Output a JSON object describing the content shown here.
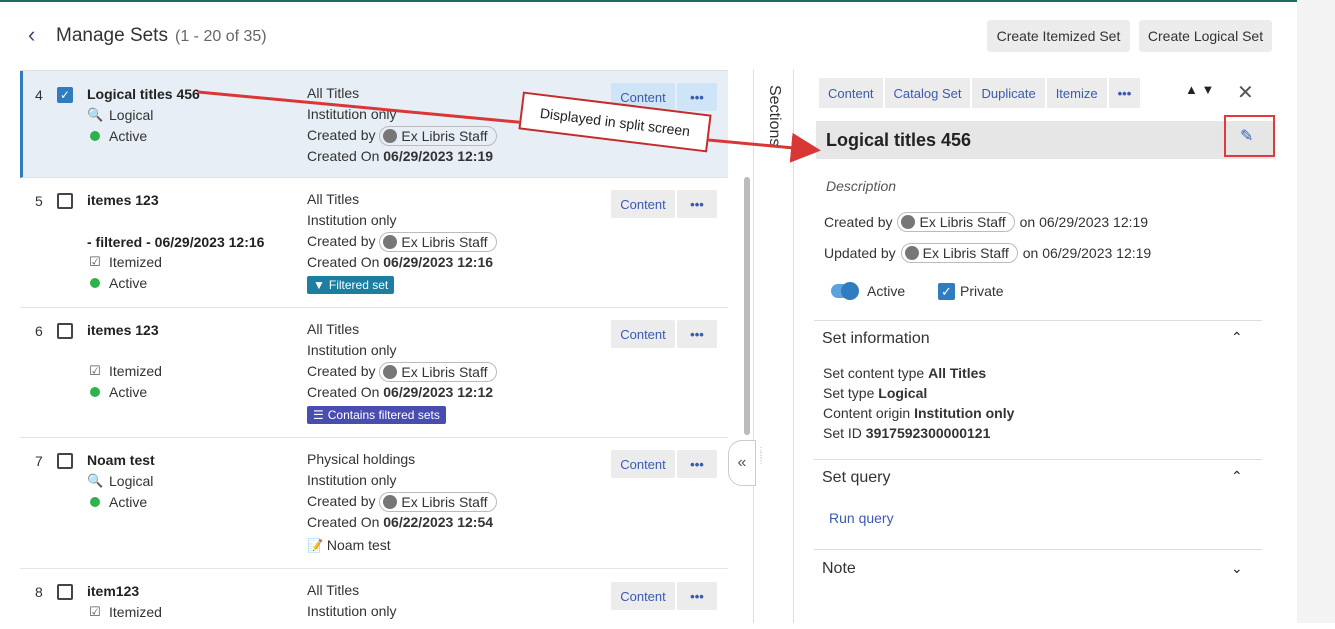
{
  "header": {
    "back_icon": "chevron-left-icon",
    "title": "Manage Sets",
    "count": "(1 - 20 of 35)",
    "create_itemized": "Create Itemized Set",
    "create_logical": "Create Logical Set"
  },
  "rows": [
    {
      "num": "4",
      "name": "Logical titles 456",
      "extra_name": "",
      "type": "Logical",
      "status": "Active",
      "content_type": "All Titles",
      "origin": "Institution only",
      "created_by_label": "Created by",
      "created_by": "Ex Libris Staff",
      "created_on_label": "Created On",
      "created_on": "06/29/2023 12:19",
      "tag": "",
      "note": "",
      "selected": true
    },
    {
      "num": "5",
      "name": "itemes 123",
      "extra_name": "- filtered - 06/29/2023 12:16",
      "type": "Itemized",
      "status": "Active",
      "content_type": "All Titles",
      "origin": "Institution only",
      "created_by_label": "Created by",
      "created_by": "Ex Libris Staff",
      "created_on_label": "Created On",
      "created_on": "06/29/2023 12:16",
      "tag": "Filtered set",
      "note": "",
      "selected": false
    },
    {
      "num": "6",
      "name": "itemes 123",
      "extra_name": "",
      "type": "Itemized",
      "status": "Active",
      "content_type": "All Titles",
      "origin": "Institution only",
      "created_by_label": "Created by",
      "created_by": "Ex Libris Staff",
      "created_on_label": "Created On",
      "created_on": "06/29/2023 12:12",
      "tag": "Contains filtered sets",
      "note": "",
      "selected": false
    },
    {
      "num": "7",
      "name": "Noam test",
      "extra_name": "",
      "type": "Logical",
      "status": "Active",
      "content_type": "Physical holdings",
      "origin": "Institution only",
      "created_by_label": "Created by",
      "created_by": "Ex Libris Staff",
      "created_on_label": "Created On",
      "created_on": "06/22/2023 12:54",
      "tag": "",
      "note": "Noam test",
      "selected": false
    },
    {
      "num": "8",
      "name": "item123",
      "extra_name": "",
      "type": "Itemized",
      "status": "",
      "content_type": "All Titles",
      "origin": "Institution only",
      "created_by_label": "",
      "created_by": "",
      "created_on_label": "",
      "created_on": "",
      "tag": "",
      "note": "",
      "selected": false
    }
  ],
  "row_buttons": {
    "content": "Content",
    "more": "•••"
  },
  "sections_label": "Sections",
  "collapse_icon": "double-chevron-left-icon",
  "annotation": "Displayed in split screen",
  "detail": {
    "tabs": [
      "Content",
      "Catalog Set",
      "Duplicate",
      "Itemize",
      "•••"
    ],
    "title": "Logical titles 456",
    "description_label": "Description",
    "created_by_label": "Created by",
    "created_by": "Ex Libris Staff",
    "created_on": "on 06/29/2023 12:19",
    "updated_by_label": "Updated by",
    "updated_by": "Ex Libris Staff",
    "updated_on": "on 06/29/2023 12:19",
    "active_label": "Active",
    "private_label": "Private",
    "set_info_title": "Set information",
    "set_info": [
      {
        "label": "Set content type",
        "value": "All Titles"
      },
      {
        "label": "Set type",
        "value": "Logical"
      },
      {
        "label": "Content origin",
        "value": "Institution only"
      },
      {
        "label": "Set ID",
        "value": "3917592300000121"
      }
    ],
    "set_query_title": "Set query",
    "run_query": "Run query",
    "note_title": "Note"
  },
  "colors": {
    "accent": "#2f7cc0",
    "annotation": "#c42b2b",
    "active_dot": "#2db34a"
  }
}
